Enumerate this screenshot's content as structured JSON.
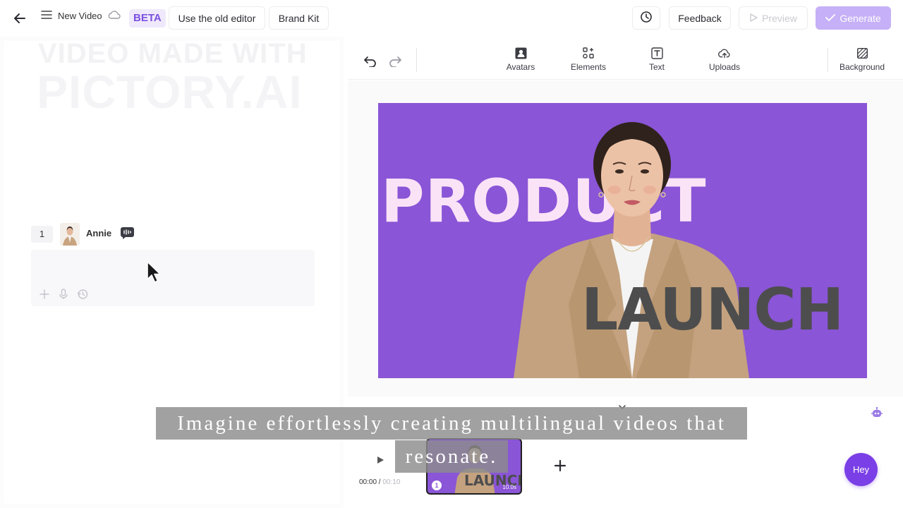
{
  "header": {
    "project_name": "New Video",
    "beta_badge": "BETA",
    "old_editor_label": "Use the old editor",
    "brand_kit_label": "Brand Kit",
    "feedback_label": "Feedback",
    "preview_label": "Preview",
    "generate_label": "Generate"
  },
  "left_panel": {
    "watermark_line1": "VIDEO MADE WITH",
    "watermark_line2": "PICTORY.AI",
    "scene": {
      "number": "1",
      "avatar_name": "Annie"
    }
  },
  "toolbar": {
    "items": [
      {
        "label": "Avatars",
        "icon": "avatar-icon"
      },
      {
        "label": "Elements",
        "icon": "elements-icon"
      },
      {
        "label": "Text",
        "icon": "text-icon"
      },
      {
        "label": "Uploads",
        "icon": "upload-icon"
      },
      {
        "label": "Background",
        "icon": "background-icon"
      }
    ]
  },
  "canvas": {
    "headline_top": "PRODUCT",
    "headline_bottom": "LAUNCH",
    "background_color": "#8a55d6"
  },
  "timeline": {
    "current_time": "00:00",
    "separator": " / ",
    "total_time": "00:10",
    "scene_thumb_text": "LAUNCH",
    "scene_thumb_number": "1",
    "scene_thumb_duration": "10.0s"
  },
  "assistant": {
    "label": "Hey"
  },
  "caption": {
    "line1": "Imagine effortlessly creating multilingual videos that",
    "line2": "resonate."
  },
  "colors": {
    "accent": "#7a3fe6",
    "generate_bg": "#c6b0f7",
    "headline_pink": "#fbe3f7",
    "headline_grey": "#4d4d4d"
  }
}
